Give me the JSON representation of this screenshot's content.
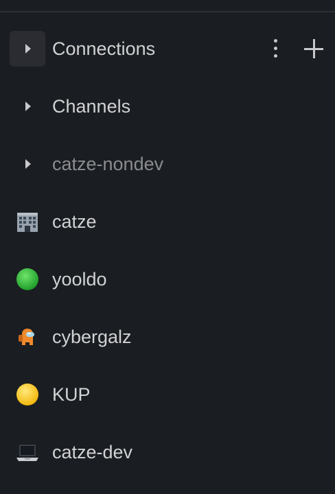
{
  "sections": [
    {
      "label": "Connections",
      "active": true
    },
    {
      "label": "Channels",
      "active": false
    },
    {
      "label": "catze-nondev",
      "active": false,
      "muted": true
    }
  ],
  "workspaces": [
    {
      "label": "catze",
      "icon": "office-building-icon"
    },
    {
      "label": "yooldo",
      "icon": "green-circle-icon"
    },
    {
      "label": "cybergalz",
      "icon": "among-us-crewmate-icon"
    },
    {
      "label": "KUP",
      "icon": "yellow-circle-icon"
    },
    {
      "label": "catze-dev",
      "icon": "laptop-icon"
    }
  ],
  "colors": {
    "background": "#1a1d21",
    "text": "#d1d2d3",
    "muted_text": "#8b8c8f",
    "active_row": "#2a2c31"
  }
}
